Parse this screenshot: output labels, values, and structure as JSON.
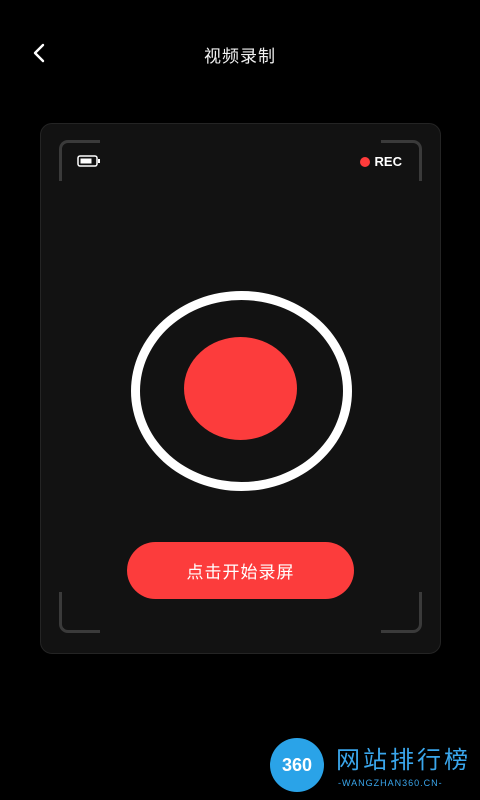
{
  "header": {
    "title": "视频录制",
    "back_icon": "chevron-left-icon"
  },
  "card": {
    "battery_icon": "battery-icon",
    "rec_label": "REC",
    "rec_color": "#ff3b3b",
    "start_button_label": "点击开始录屏",
    "accent_color": "#fc3c3c"
  },
  "watermark": {
    "logo_text": "360",
    "title": "网站排行榜",
    "subtitle": "-WANGZHAN360.CN-"
  }
}
